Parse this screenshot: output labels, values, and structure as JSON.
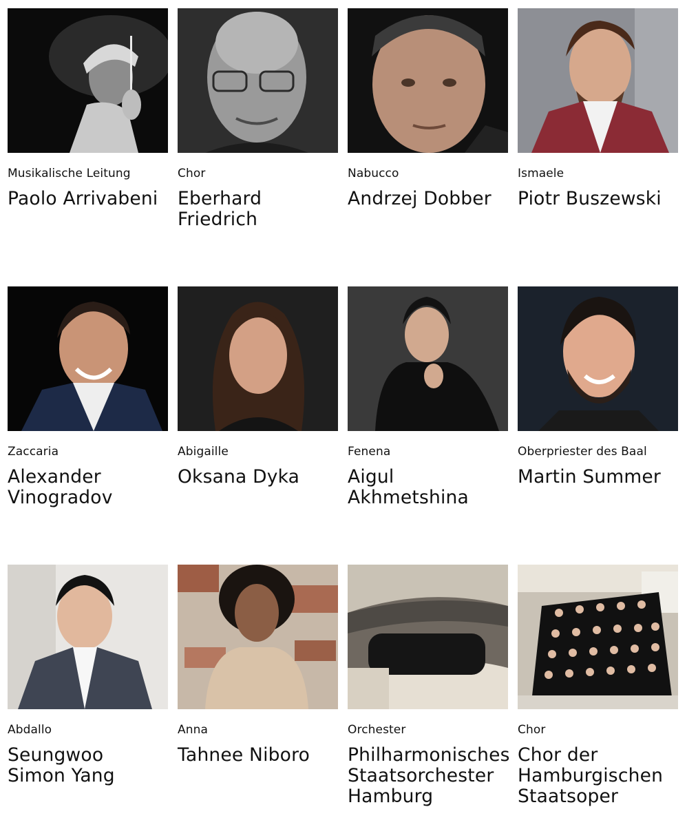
{
  "cast": [
    {
      "role": "Musikalische Leitung",
      "name": "Paolo Arrivabeni",
      "photo": "portrait-conductor-bw"
    },
    {
      "role": "Chor",
      "name": "Eberhard\nFriedrich",
      "photo": "portrait-chorus-master-bw"
    },
    {
      "role": "Nabucco",
      "name": "Andrzej Dobber",
      "photo": "portrait-baritone"
    },
    {
      "role": "Ismaele",
      "name": "Piotr Buszewski",
      "photo": "portrait-tenor"
    },
    {
      "role": "Zaccaria",
      "name": "Alexander\nVinogradov",
      "photo": "portrait-bass"
    },
    {
      "role": "Abigaille",
      "name": "Oksana Dyka",
      "photo": "portrait-soprano"
    },
    {
      "role": "Fenena",
      "name": "Aigul\nAkhmetshina",
      "photo": "portrait-mezzo"
    },
    {
      "role": "Oberpriester des Baal",
      "name": "Martin Summer",
      "photo": "portrait-bass-2"
    },
    {
      "role": "Abdallo",
      "name": "Seungwoo\nSimon Yang",
      "photo": "portrait-tenor-2"
    },
    {
      "role": "Anna",
      "name": "Tahnee Niboro",
      "photo": "portrait-soprano-2"
    },
    {
      "role": "Orchester",
      "name": "Philharmonisches\nStaatsorchester\nHamburg",
      "photo": "photo-orchestra"
    },
    {
      "role": "Chor",
      "name": "Chor der\nHamburgischen\nStaatsoper",
      "photo": "photo-choir"
    }
  ],
  "colors": {
    "text": "#111111",
    "background": "#ffffff"
  }
}
